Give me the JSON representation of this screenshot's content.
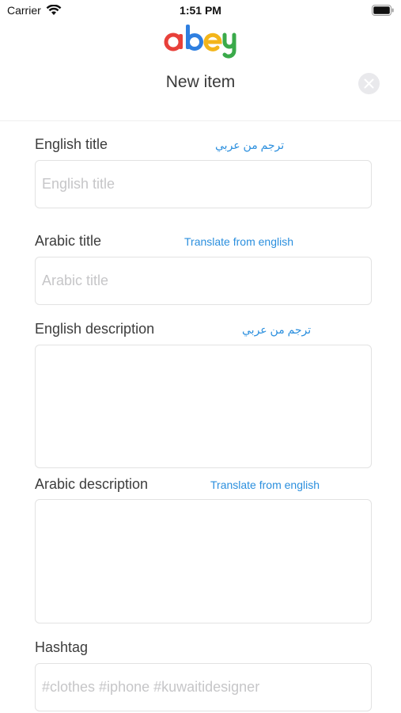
{
  "status_bar": {
    "carrier": "Carrier",
    "time": "1:51 PM"
  },
  "header": {
    "logo_text": "abey",
    "logo_colors": [
      "#e8403a",
      "#2f7fe0",
      "#f3b51a",
      "#3aaa4a"
    ],
    "title": "New item",
    "close_icon": "close-icon"
  },
  "form": {
    "english_title": {
      "label": "English title",
      "link": "ترجم من عربي",
      "placeholder": "English title"
    },
    "arabic_title": {
      "label": "Arabic title",
      "link": "Translate from english",
      "placeholder": "Arabic title"
    },
    "english_description": {
      "label": "English description",
      "link": "ترجم من عربي",
      "placeholder": ""
    },
    "arabic_description": {
      "label": "Arabic description",
      "link": "Translate from english",
      "placeholder": ""
    },
    "hashtag": {
      "label": "Hashtag",
      "placeholder": "#clothes #iphone #kuwaitidesigner"
    }
  },
  "colors": {
    "link": "#2b8fde",
    "label": "#3c3c3c",
    "placeholder": "#c6c6c8",
    "border": "#e2e2e2"
  }
}
